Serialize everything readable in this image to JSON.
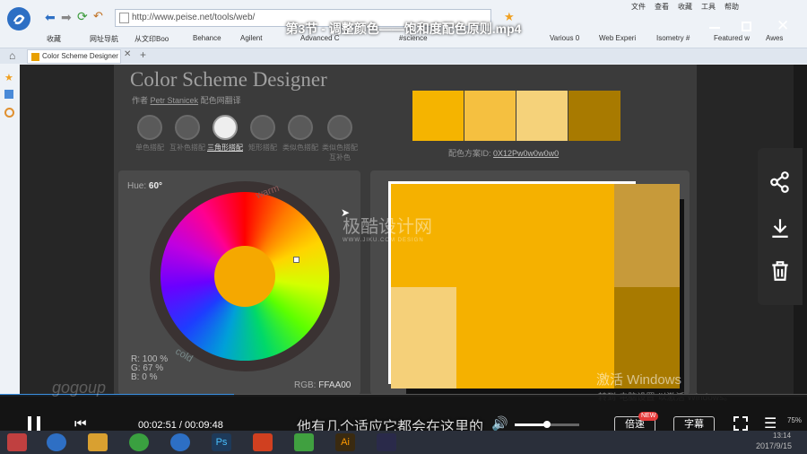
{
  "video_title": "第3节 - 调整颜色——饱和度配色原则.mp4",
  "browser": {
    "url": "http://www.peise.net/tools/web/",
    "menu": [
      "文件",
      "查看",
      "收藏",
      "工具",
      "帮助"
    ],
    "bookmarks": [
      "收藏",
      "网址导航",
      "从文印Boo",
      "Behance",
      "Agilent",
      "Advanced C",
      "#science",
      "Various 0",
      "Web Experi",
      "Isometry #",
      "Featured w",
      "Awes"
    ],
    "tab_label": "Color Scheme Designer"
  },
  "csd": {
    "title": "Color Scheme Designer",
    "subtitle_prefix": "作者",
    "author": "Petr Stanicek",
    "subtitle_suffix": "配色网翻译",
    "modes": [
      {
        "label": "单色搭配",
        "active": false
      },
      {
        "label": "互补色搭配",
        "active": false
      },
      {
        "label": "三角形搭配",
        "active": true
      },
      {
        "label": "矩形搭配",
        "active": false
      },
      {
        "label": "类似色搭配",
        "active": false
      },
      {
        "label": "类似色搭配互补色",
        "active": false
      }
    ],
    "hue_label": "Hue:",
    "hue_value": "60°",
    "warm": "warm",
    "cold": "cold",
    "palette_id_label": "配色方案ID:",
    "palette_id": "0X12Pw0w0w0w0",
    "rgb_label": "RGB:",
    "rgb_value": "FFAA00",
    "r_line": "R: 100 %",
    "g_line": "G:   67 %",
    "b_line": "B:     0 %",
    "swatches": [
      "#f5b400",
      "#f5c040",
      "#f5d27a",
      "#a87a00"
    ],
    "watermark": "极酷设计网",
    "watermark_sub": "WWW.JIKU.COM   DESIGN",
    "activate_windows": "激活 Windows",
    "activate_sub": "转到“电脑设置”以激活 Windows。"
  },
  "player": {
    "time_current": "00:02:51",
    "time_total": "00:09:48",
    "subtitle": "他有几个适应它都会在这里的",
    "progress": 0.29,
    "volume": 0.5,
    "speed_label": "倍速",
    "speed_badge": "NEW",
    "caption_label": "字幕",
    "bottom_watermark": "gogoup"
  },
  "statusbar": {
    "zoom": "75%",
    "time": "13:14",
    "date": "2017/9/15"
  },
  "colors": {
    "accent": "#3b8fe0",
    "gold": "#f5b400"
  }
}
